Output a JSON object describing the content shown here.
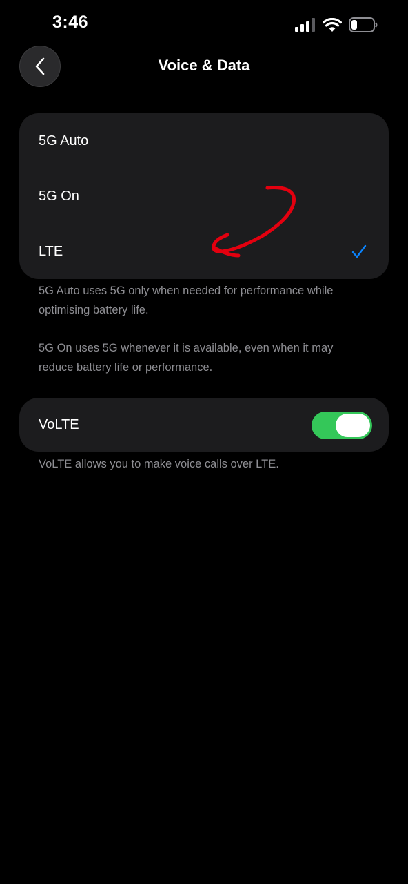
{
  "status_bar": {
    "time": "3:46",
    "icons": [
      "cellular-signal-icon",
      "wifi-icon",
      "battery-icon"
    ]
  },
  "nav": {
    "title": "Voice & Data",
    "back_icon": "chevron-left-icon"
  },
  "options": {
    "items": [
      {
        "label": "5G Auto",
        "selected": false
      },
      {
        "label": "5G On",
        "selected": false
      },
      {
        "label": "LTE",
        "selected": true
      }
    ],
    "check_color": "#0a84ff"
  },
  "footnotes": {
    "five_g_auto": "5G Auto uses 5G only when needed for performance while optimising battery life.",
    "five_g_on": "5G On uses 5G whenever it is available, even when it may reduce battery life or performance.",
    "volte": "VoLTE allows you to make voice calls over LTE."
  },
  "volte": {
    "label": "VoLTE",
    "enabled": true,
    "toggle_color": "#34c759"
  },
  "annotation": {
    "type": "hand-drawn-arrow-icon",
    "color": "#e3000f"
  }
}
